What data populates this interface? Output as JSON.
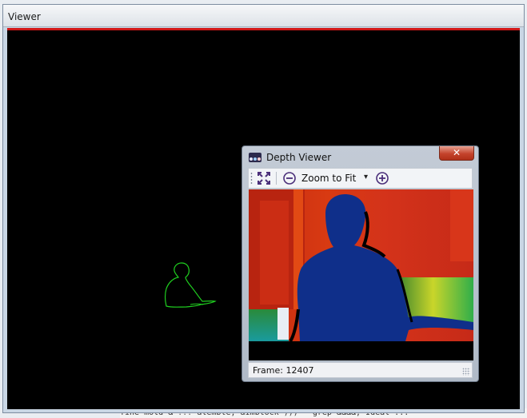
{
  "background": {
    "terminal_text": "fine mold & ??? alemble, aimblock ))) - grep &&&&, Ideal ..."
  },
  "viewer": {
    "title": "Viewer"
  },
  "depth_viewer": {
    "title": "Depth Viewer",
    "close_label": "✕",
    "toolbar": {
      "fit_icon": "expand-arrows-icon",
      "zoom_out_icon": "zoom-out-icon",
      "zoom_label": "Zoom to Fit",
      "dropdown_glyph": "▾",
      "zoom_in_icon": "zoom-in-icon"
    },
    "status": "Frame: 12407"
  },
  "colors": {
    "canvas": "#000000",
    "silhouette": "#1fcf1f",
    "depth_near": "#0f2f8a",
    "depth_far": "#c82a10",
    "accent_toolbar_icon": "#4b2f7a"
  }
}
